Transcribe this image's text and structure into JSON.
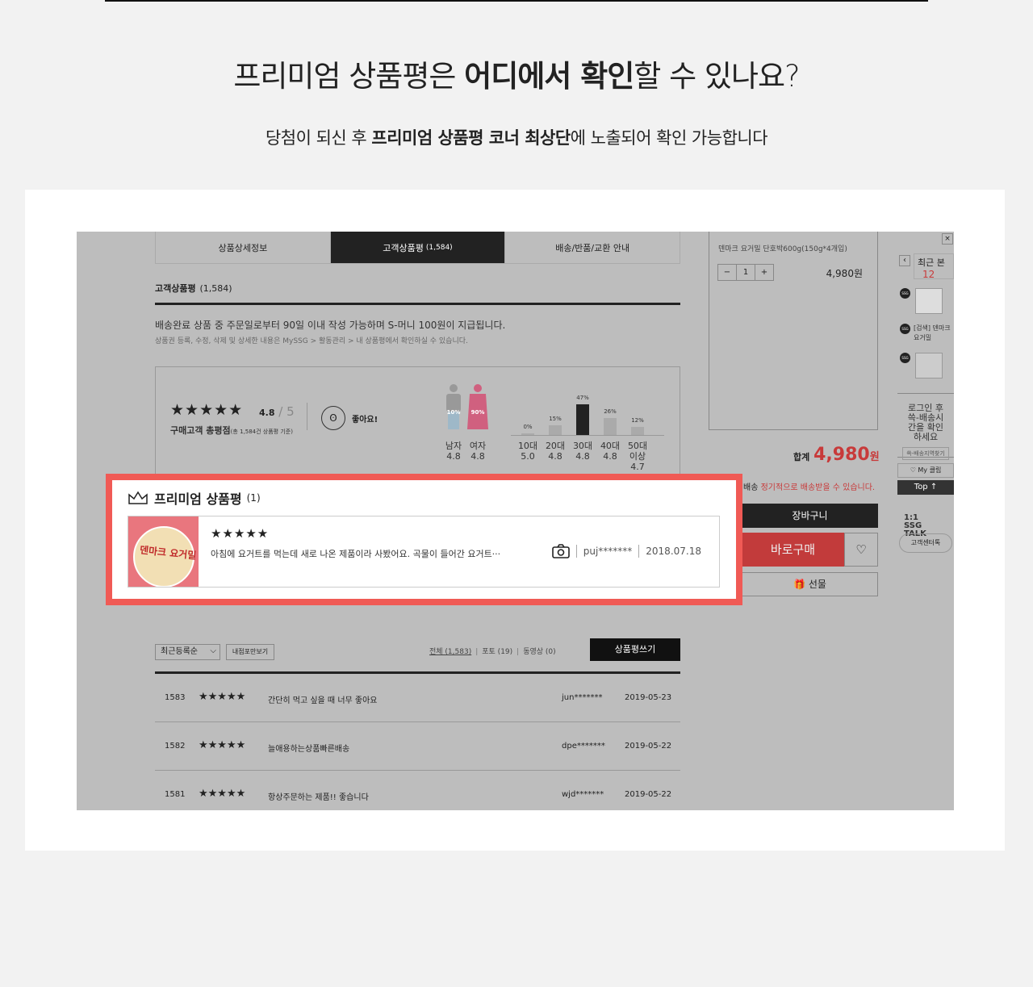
{
  "heading": {
    "title_pre": "프리미엄 상품평은 ",
    "title_bold": "어디에서 확인",
    "title_post": "할 수 있나요?",
    "sub_pre": "당첨이 되신 후 ",
    "sub_bold": "프리미엄 상품평 코너 최상단",
    "sub_post": "에 노출되어 확인 가능합니다"
  },
  "tabs": [
    {
      "label": "상품상세정보",
      "count": ""
    },
    {
      "label": "고객상품평",
      "count": "(1,584)"
    },
    {
      "label": "배송/반품/교환 안내",
      "count": ""
    }
  ],
  "section": {
    "title": "고객상품평",
    "count": "(1,584)",
    "notice": "배송완료 상품 중 주문일로부터 90일 이내 작성 가능하며 S-머니 100원이 지급됩니다.",
    "notice_sub": "상품권 등록, 수정, 삭제 및 상세한 내용은 MySSG > 활동관리 > 내 상품평에서 확인하실 수 있습니다."
  },
  "summary": {
    "stars": "★★★★★",
    "score": "4.8",
    "score_max": "/ 5",
    "label": "구매고객 총평점",
    "label_sub": "(총 1,584건 상품평 기준)",
    "face": "ʘ",
    "mood": "좋아요!",
    "gender": [
      {
        "name": "남자",
        "score": "4.8",
        "pct": "10%"
      },
      {
        "name": "여자",
        "score": "4.8",
        "pct": "90%"
      }
    ],
    "ages": [
      {
        "name": "10대",
        "score": "5.0",
        "pct": "0%",
        "value": 0
      },
      {
        "name": "20대",
        "score": "4.8",
        "pct": "15%",
        "value": 15
      },
      {
        "name": "30대",
        "score": "4.8",
        "pct": "47%",
        "value": 47
      },
      {
        "name": "40대",
        "score": "4.8",
        "pct": "26%",
        "value": 26
      },
      {
        "name": "50대이상",
        "score": "4.7",
        "pct": "12%",
        "value": 12
      }
    ]
  },
  "order": {
    "product_name": "덴마크 요거밀 단호박600g(150g*4개입)",
    "qty_minus": "−",
    "qty": "1",
    "qty_plus": "+",
    "price": "4,980원",
    "total_label": "합계",
    "total_value": "4,980",
    "total_unit": "원",
    "subscribe_prefix": "배송",
    "subscribe_text": "정기적으로 배송받을 수 있습니다.",
    "cart_label": "장바구니",
    "buy_label": "바로구매",
    "wish_icon": "♡",
    "gift_label": "🎁 선물"
  },
  "quickbar": {
    "close": "×",
    "prev": "‹",
    "recent_label": "최근 본",
    "recent_count": "12",
    "ssg": "SSG",
    "item_text": "[검색] 덴마크 요거밀",
    "login_text": "로그인 후 쓱-배송시간을 확인하세요",
    "region_label": "쓱-배송지역찾기",
    "myclip_label": "♡ My 클립",
    "top_label": "Top ↑",
    "talk_label": "1:1 SSG TALK",
    "cs_label": "고객센터톡"
  },
  "premium": {
    "title": "프리미엄 상품평",
    "count": "(1)",
    "img_label": "덴마크 요거밀",
    "stars": "★★★★★",
    "text": "아침에 요거트를 먹는데 새로 나온 제품이라 사봤어요. 곡물이 들어간 요거트···",
    "user": "puj*******",
    "date": "2018.07.18"
  },
  "controls": {
    "sort_label": "최근등록순",
    "sort_arrow": "⌵",
    "mine_label": "내점포만보기",
    "filter_all": "전체 (1,583)",
    "filter_photo": "포토 (19)",
    "filter_video": "동영상 (0)",
    "filter_sep": "|",
    "write_label": "상품평쓰기"
  },
  "reviews": [
    {
      "no": "1583",
      "stars": "★★★★★",
      "text": "간단히 먹고 싶을 때 너무 좋아요",
      "user": "jun*******",
      "date": "2019-05-23"
    },
    {
      "no": "1582",
      "stars": "★★★★★",
      "text": "늘애용하는상품빠른배송",
      "user": "dpe*******",
      "date": "2019-05-22"
    },
    {
      "no": "1581",
      "stars": "★★★★★",
      "text": "항상주문하는 제품!! 좋습니다",
      "user": "wjd*******",
      "date": "2019-05-22"
    }
  ],
  "colors": {
    "accent": "#f05a55",
    "brand_red": "#c83a3a",
    "dark": "#222222"
  }
}
